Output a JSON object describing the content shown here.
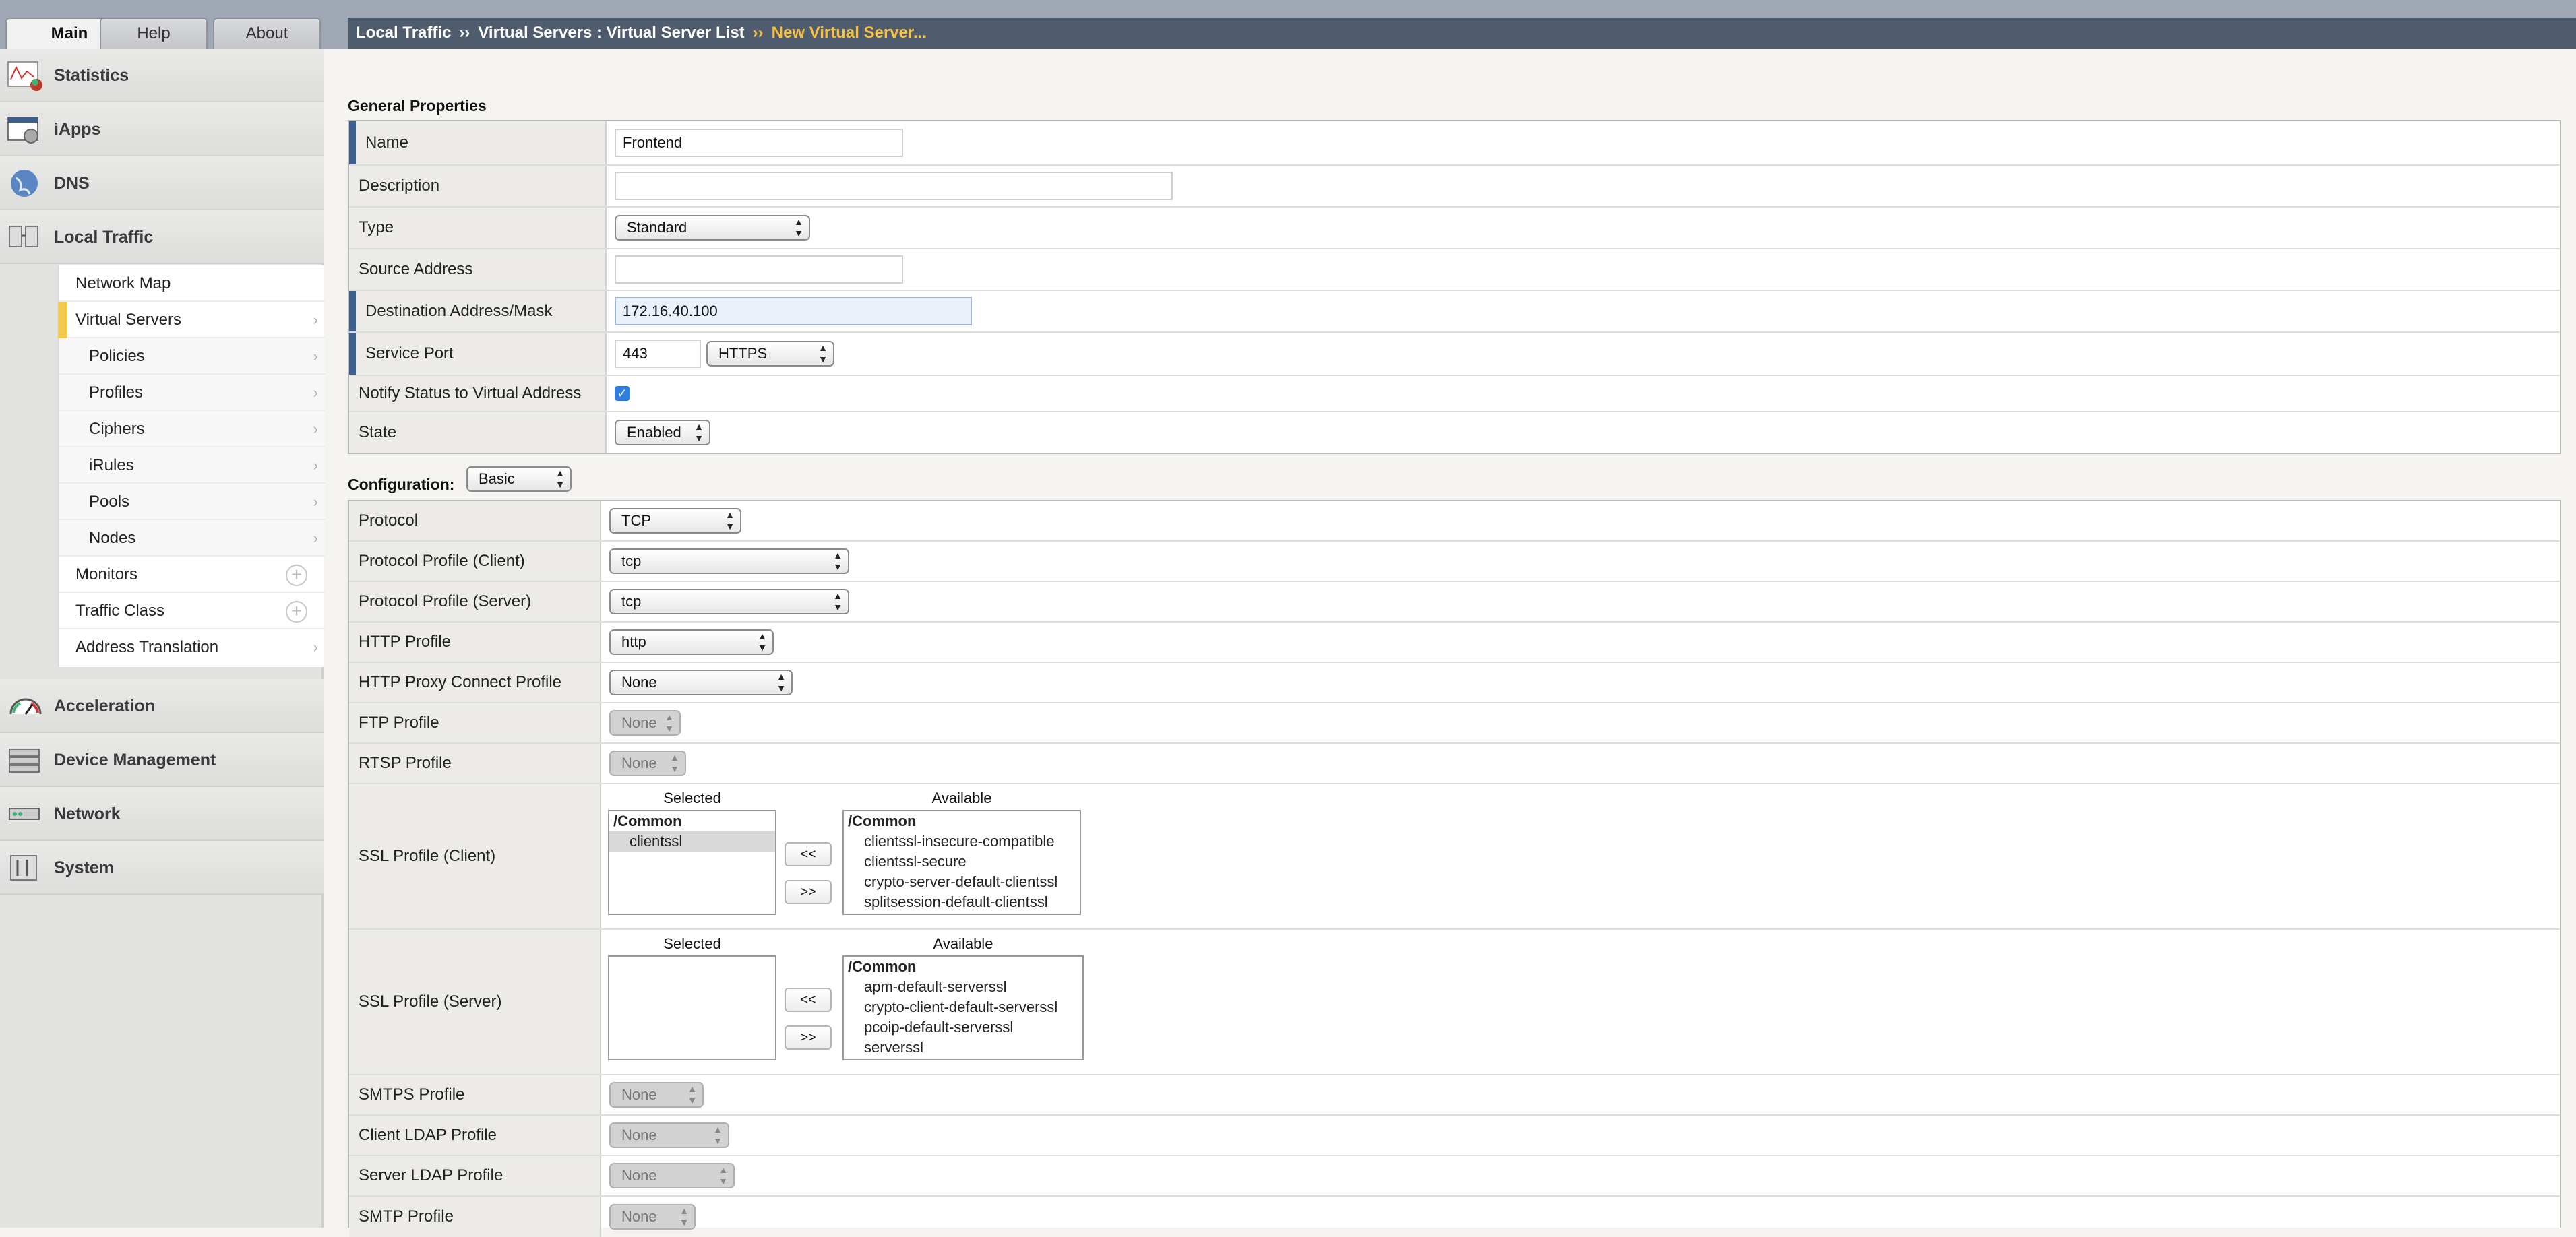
{
  "tabs": [
    {
      "label": "Main"
    },
    {
      "label": "Help"
    },
    {
      "label": "About"
    }
  ],
  "nav": {
    "sections": [
      {
        "label": "Statistics",
        "icon": "statistics-icon"
      },
      {
        "label": "iApps",
        "icon": "iapps-icon"
      },
      {
        "label": "DNS",
        "icon": "dns-globe-icon"
      },
      {
        "label": "Local Traffic",
        "icon": "local-traffic-icon"
      },
      {
        "label": "Acceleration",
        "icon": "acceleration-gauge-icon"
      },
      {
        "label": "Device Management",
        "icon": "device-management-icon"
      },
      {
        "label": "Network",
        "icon": "network-icon"
      },
      {
        "label": "System",
        "icon": "system-icon"
      }
    ],
    "local_traffic_items": [
      {
        "label": "Network Map"
      },
      {
        "label": "Virtual Servers",
        "arrow": "›"
      },
      {
        "label": "Policies",
        "arrow": "›"
      },
      {
        "label": "Profiles",
        "arrow": "›"
      },
      {
        "label": "Ciphers",
        "arrow": "›"
      },
      {
        "label": "iRules",
        "arrow": "›"
      },
      {
        "label": "Pools",
        "arrow": "›"
      },
      {
        "label": "Nodes",
        "arrow": "›"
      },
      {
        "label": "Monitors",
        "plus": "+"
      },
      {
        "label": "Traffic Class",
        "plus": "+"
      },
      {
        "label": "Address Translation",
        "arrow": "›"
      }
    ]
  },
  "breadcrumb": {
    "part1": "Local Traffic",
    "sep1": "››",
    "part2": "Virtual Servers : Virtual Server List",
    "sep2": "››",
    "part3": "New Virtual Server..."
  },
  "general": {
    "title": "General Properties",
    "rows": [
      {
        "label": "Name",
        "value": "Frontend"
      },
      {
        "label": "Description",
        "value": ""
      },
      {
        "label": "Type",
        "value": "Standard"
      },
      {
        "label": "Source Address",
        "value": ""
      },
      {
        "label": "Destination Address/Mask",
        "value": "172.16.40.100"
      },
      {
        "label": "Service Port",
        "value": "443",
        "service": "HTTPS"
      },
      {
        "label": "Notify Status to Virtual Address",
        "value": "✓"
      },
      {
        "label": "State",
        "value": "Enabled"
      }
    ]
  },
  "configuration": {
    "title": "Configuration:",
    "mode": "Basic",
    "rows": [
      {
        "label": "Protocol",
        "value": "TCP"
      },
      {
        "label": "Protocol Profile (Client)",
        "value": "tcp"
      },
      {
        "label": "Protocol Profile (Server)",
        "value": "tcp"
      },
      {
        "label": "HTTP Profile",
        "value": "http"
      },
      {
        "label": "HTTP Proxy Connect Profile",
        "value": "None"
      },
      {
        "label": "FTP Profile",
        "value": "None"
      },
      {
        "label": "RTSP Profile",
        "value": "None"
      },
      {
        "label": "SSL Profile (Client)"
      },
      {
        "label": "SSL Profile (Server)"
      },
      {
        "label": "SMTPS Profile",
        "value": "None"
      },
      {
        "label": "Client LDAP Profile",
        "value": "None"
      },
      {
        "label": "Server LDAP Profile",
        "value": "None"
      },
      {
        "label": "SMTP Profile",
        "value": "None"
      }
    ]
  },
  "ssl_client": {
    "selected_header": "Selected",
    "available_header": "Available",
    "selected_group": "/Common",
    "selected_items": [
      "clientssl"
    ],
    "available_group": "/Common",
    "available_items": [
      "clientssl-insecure-compatible",
      "clientssl-secure",
      "crypto-server-default-clientssl",
      "splitsession-default-clientssl"
    ],
    "btn_left": "<<",
    "btn_right": ">>"
  },
  "ssl_server": {
    "selected_header": "Selected",
    "available_header": "Available",
    "available_group": "/Common",
    "available_items": [
      "apm-default-serverssl",
      "crypto-client-default-serverssl",
      "pcoip-default-serverssl",
      "serverssl"
    ],
    "btn_left": "<<",
    "btn_right": ">>"
  },
  "colors": {
    "breadcrumb_bg": "#4f5c6d",
    "highlight": "#f5c043",
    "required_marker": "#3d5f8e",
    "selected_nav": "#f2c94c"
  }
}
